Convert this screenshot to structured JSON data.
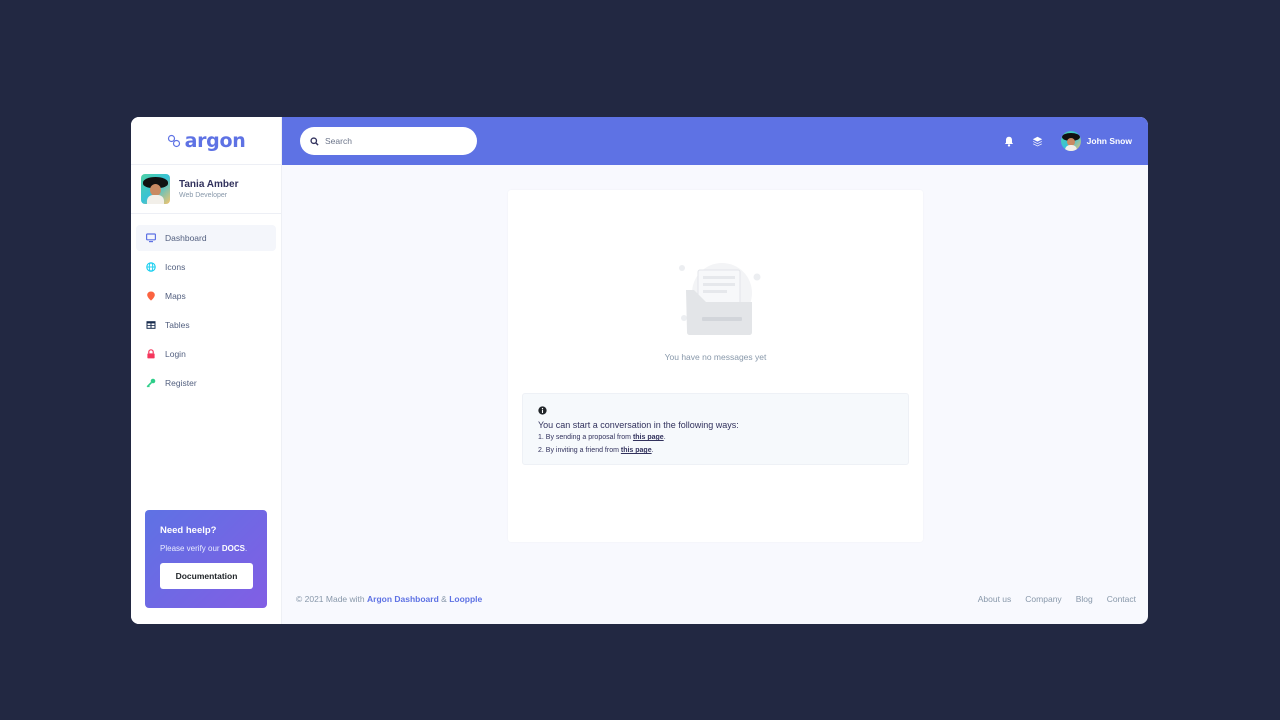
{
  "brand": {
    "name": "argon"
  },
  "profile": {
    "name": "Tania Amber",
    "role": "Web Developer"
  },
  "sidebar": {
    "items": [
      {
        "label": "Dashboard",
        "icon": "monitor-icon",
        "color": "#5e72e4",
        "active": true
      },
      {
        "label": "Icons",
        "icon": "globe-icon",
        "color": "#11cdef",
        "active": false
      },
      {
        "label": "Maps",
        "icon": "pin-icon",
        "color": "#fb6340",
        "active": false
      },
      {
        "label": "Tables",
        "icon": "table-icon",
        "color": "#172b4d",
        "active": false
      },
      {
        "label": "Login",
        "icon": "lock-icon",
        "color": "#f5365c",
        "active": false
      },
      {
        "label": "Register",
        "icon": "key-icon",
        "color": "#2dce89",
        "active": false
      }
    ]
  },
  "help": {
    "title": "Need heelp?",
    "text_prefix": "Please verify our ",
    "text_bold": "DOCS",
    "text_suffix": ".",
    "button": "Documentation"
  },
  "search": {
    "placeholder": "Search"
  },
  "user": {
    "name": "John Snow"
  },
  "empty_state": {
    "text": "You have no messages yet"
  },
  "info": {
    "title": "You can start a conversation in the following ways:",
    "line1_prefix": "1. By sending a proposal from ",
    "line1_link": "this page",
    "line1_suffix": ".",
    "line2_prefix": "2. By inviting a friend from ",
    "line2_link": "this page",
    "line2_suffix": "."
  },
  "footer": {
    "copyright": "© 2021 Made with ",
    "link1": "Argon Dashboard",
    "amp": " & ",
    "link2": "Loopple",
    "links": [
      "About us",
      "Company",
      "Blog",
      "Contact"
    ]
  },
  "colors": {
    "primary": "#5e72e4",
    "background": "#222842",
    "gradient_end": "#825ee4"
  }
}
